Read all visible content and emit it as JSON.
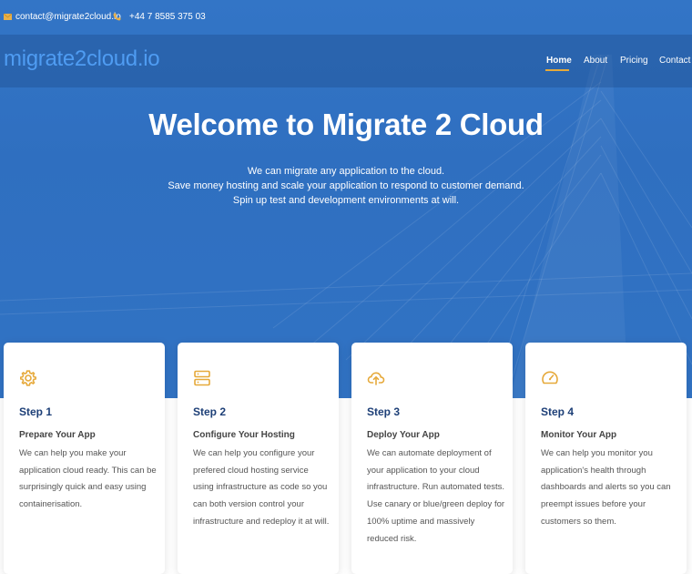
{
  "topbar": {
    "email": "contact@migrate2cloud.io",
    "phone": "+44 7 8585 375 03"
  },
  "navbar": {
    "logo": "migrate2cloud.io",
    "links": [
      {
        "label": "Home",
        "active": true
      },
      {
        "label": "About",
        "active": false
      },
      {
        "label": "Pricing",
        "active": false
      },
      {
        "label": "Contact",
        "active": false
      }
    ]
  },
  "hero": {
    "title": "Welcome to Migrate 2 Cloud",
    "lines": [
      "We can migrate any application to the cloud.",
      "Save money hosting and scale your application to respond to customer demand.",
      "Spin up test and development environments at will."
    ]
  },
  "cards": [
    {
      "icon": "gear-icon",
      "step": "Step 1",
      "title": "Prepare Your App",
      "description": "We can help you make your application cloud ready. This can be surprisingly quick and easy using containerisation."
    },
    {
      "icon": "server-icon",
      "step": "Step 2",
      "title": "Configure Your Hosting",
      "description": "We can help you configure your prefered cloud hosting service using infrastructure as code so you can both version control your infrastructure and redeploy it at will."
    },
    {
      "icon": "cloud-upload-icon",
      "step": "Step 3",
      "title": "Deploy Your App",
      "description": "We can automate deployment of your application to your cloud infrastructure. Run automated tests. Use canary or blue/green deploy for 100% uptime and massively reduced risk."
    },
    {
      "icon": "gauge-icon",
      "step": "Step 4",
      "title": "Monitor Your App",
      "description": "We can help you monitor you application's health through dashboards and alerts so you can preempt issues before your customers so them."
    }
  ],
  "colors": {
    "hero_blue": "#3173c4",
    "accent": "#e6a93a",
    "logo": "#4f9cf2",
    "step_heading": "#1d3f77"
  }
}
